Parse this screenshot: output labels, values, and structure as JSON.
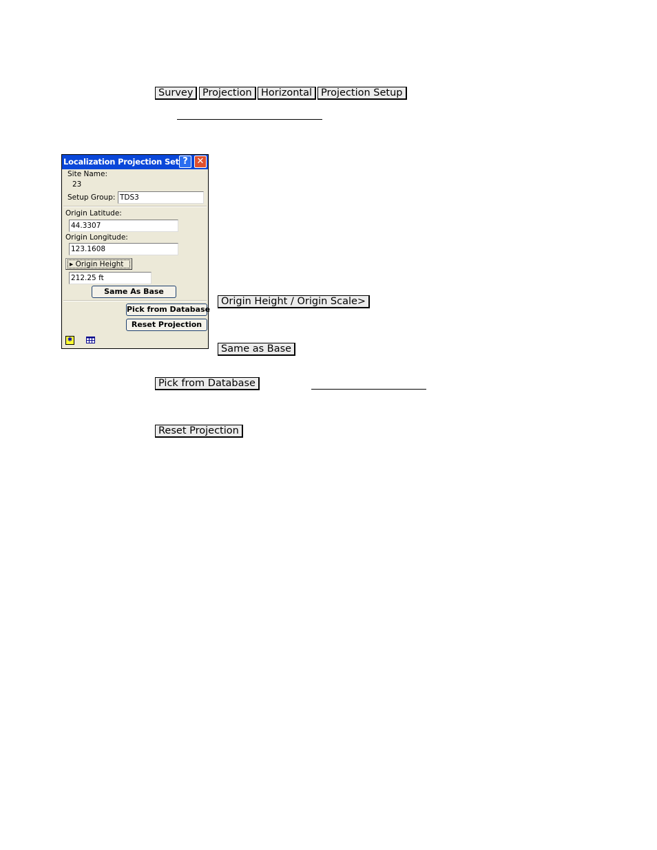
{
  "breadcrumb": [
    "Survey",
    "Projection",
    "Horizontal",
    "Projection Setup"
  ],
  "dialog": {
    "title": "Localization Projection Setup",
    "help_label": "?",
    "close_label": "✕",
    "site_name_label": "Site Name:",
    "site_name_value": "23",
    "setup_group_label": "Setup Group:",
    "setup_group_value": "TDS3",
    "origin_latitude_label": "Origin Latitude:",
    "origin_latitude_value": "44.3307",
    "origin_longitude_label": "Origin Longitude:",
    "origin_longitude_value": "123.1608",
    "origin_height_toggle": "Origin Height",
    "origin_height_value": "212.25 ft",
    "same_as_base": "Same As Base",
    "pick_from_database": "Pick from Database",
    "reset_projection": "Reset Projection",
    "status_icons": [
      "sun-icon",
      "grid-icon"
    ]
  },
  "doc_buttons": {
    "origin_height_scale": "Origin Height / Origin Scale>",
    "same_as_base": "Same as Base",
    "pick_from_database": "Pick from Database",
    "reset_projection": "Reset Projection"
  }
}
